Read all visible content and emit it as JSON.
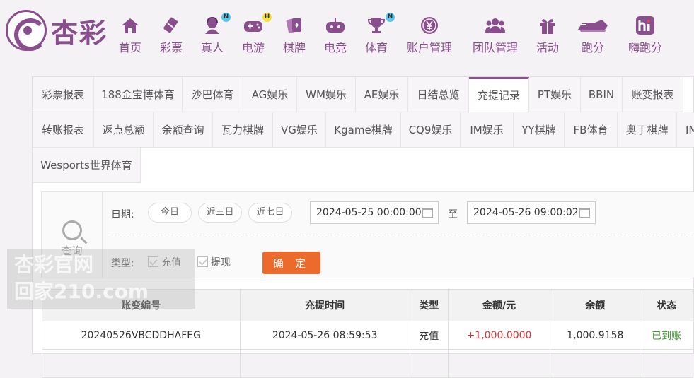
{
  "brand": {
    "name": "杏彩"
  },
  "nav": [
    {
      "label": "首页",
      "icon": "home-icon",
      "badge": ""
    },
    {
      "label": "彩票",
      "icon": "lottery-icon",
      "badge": ""
    },
    {
      "label": "真人",
      "icon": "live-dealer-icon",
      "badge": "N"
    },
    {
      "label": "电游",
      "icon": "gamepad-icon",
      "badge": "H"
    },
    {
      "label": "棋牌",
      "icon": "cards-icon",
      "badge": ""
    },
    {
      "label": "电竞",
      "icon": "esports-icon",
      "badge": ""
    },
    {
      "label": "体育",
      "icon": "trophy-icon",
      "badge": "N"
    },
    {
      "label": "账户管理",
      "icon": "yen-icon",
      "badge": ""
    },
    {
      "label": "团队管理",
      "icon": "team-icon",
      "badge": ""
    },
    {
      "label": "活动",
      "icon": "gift-icon",
      "badge": ""
    },
    {
      "label": "跑分",
      "icon": "run-score-icon",
      "badge": ""
    },
    {
      "label": "嗨跑分",
      "icon": "hi-app-icon",
      "badge": ""
    }
  ],
  "tabs": {
    "row1": [
      "彩票报表",
      "188金宝博体育",
      "沙巴体育",
      "AG娱乐",
      "WM娱乐",
      "AE娱乐",
      "日结总览",
      "充提记录",
      "PT娱乐",
      "BBIN",
      "账变报表"
    ],
    "row2": [
      "转账报表",
      "返点总额",
      "余额查询",
      "瓦力棋牌",
      "VG娱乐",
      "Kgame棋牌",
      "CQ9娱乐",
      "IM娱乐",
      "YY棋牌",
      "FB体育",
      "奥丁棋牌",
      "IM"
    ],
    "row3": [
      "Wesports世界体育"
    ],
    "active": "充提记录"
  },
  "filter": {
    "query_label": "查询",
    "date_label": "日期:",
    "quick": [
      "今日",
      "近三日",
      "近七日"
    ],
    "start": "2024-05-25 00:00:00",
    "to": "至",
    "end": "2024-05-26 09:00:02",
    "type_label": "类型:",
    "types": [
      "充值",
      "提现"
    ],
    "confirm": "确 定"
  },
  "table": {
    "headers": [
      "账变编号",
      "充提时间",
      "类型",
      "金额/元",
      "余额",
      "状态"
    ],
    "rows": [
      {
        "id": "20240526VBCDDHAFEG",
        "time": "2024-05-26 08:59:53",
        "type": "充值",
        "amount": "+1,000.0000",
        "balance": "1,000.9158",
        "status": "已到账"
      }
    ]
  },
  "watermark": {
    "line1": "杏彩官网",
    "line2": "回家210.com"
  },
  "colors": {
    "brand": "#8a4e8f",
    "confirm": "#ec6a2c",
    "amount": "#e03030",
    "status": "#3a9a2a"
  }
}
